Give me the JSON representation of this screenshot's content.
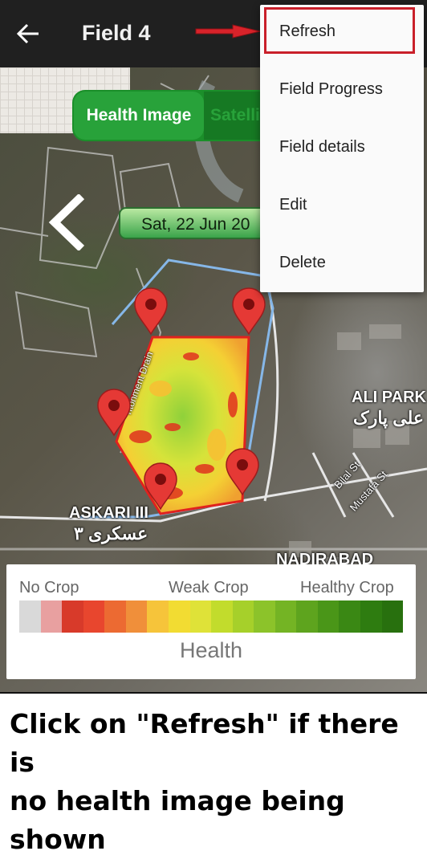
{
  "appbar": {
    "title": "Field 4"
  },
  "view_toggle": {
    "health_label": "Health Image",
    "satellite_label": "Satellite"
  },
  "date_pill": {
    "text": "Sat, 22 Jun 20"
  },
  "menu": {
    "items": [
      "Refresh",
      "Field Progress",
      "Field details",
      "Edit",
      "Delete"
    ],
    "highlighted": "Refresh"
  },
  "map_labels": {
    "ali_park_en": "ALI PARK",
    "ali_park_ur": "علی پارک",
    "askari_en": "ASKARI III",
    "askari_ur": "عسکری ٣",
    "nadirabad": "NADIRABAD",
    "bilal_st": "Bilal St",
    "mustafa_st": "Mustafa St",
    "cantonment_drain": "ntonment Drain"
  },
  "legend": {
    "no_crop": "No Crop",
    "weak_crop": "Weak Crop",
    "healthy_crop": "Healthy Crop",
    "title": "Health",
    "colors": [
      "#d9d9d9",
      "#e8a0a0",
      "#d83a2a",
      "#e8462e",
      "#ec6a32",
      "#f08f3a",
      "#f6c43a",
      "#f2dc32",
      "#dfe238",
      "#c2dc2c",
      "#a6d02a",
      "#8cc32a",
      "#74b424",
      "#5ea41e",
      "#4a9618",
      "#3a8814",
      "#2e7c10",
      "#28700e"
    ]
  },
  "instruction": {
    "line1": "Click on \"Refresh\" if there is",
    "line2": "no health image being shown"
  },
  "colors": {
    "appbar": "#202020",
    "accent_green": "#28a23a",
    "highlight_red": "#c91f2a"
  }
}
